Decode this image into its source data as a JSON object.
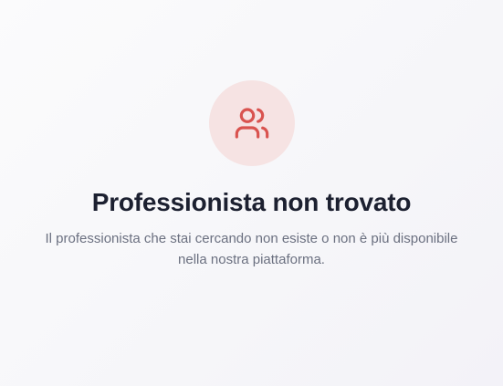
{
  "empty_state": {
    "icon": "users-icon",
    "accent_color": "#d9534f",
    "icon_background": "#f6e3e3",
    "title": "Professionista non trovato",
    "message": "Il professionista che stai cercando non esiste o non è più disponibile nella nostra piattaforma."
  }
}
